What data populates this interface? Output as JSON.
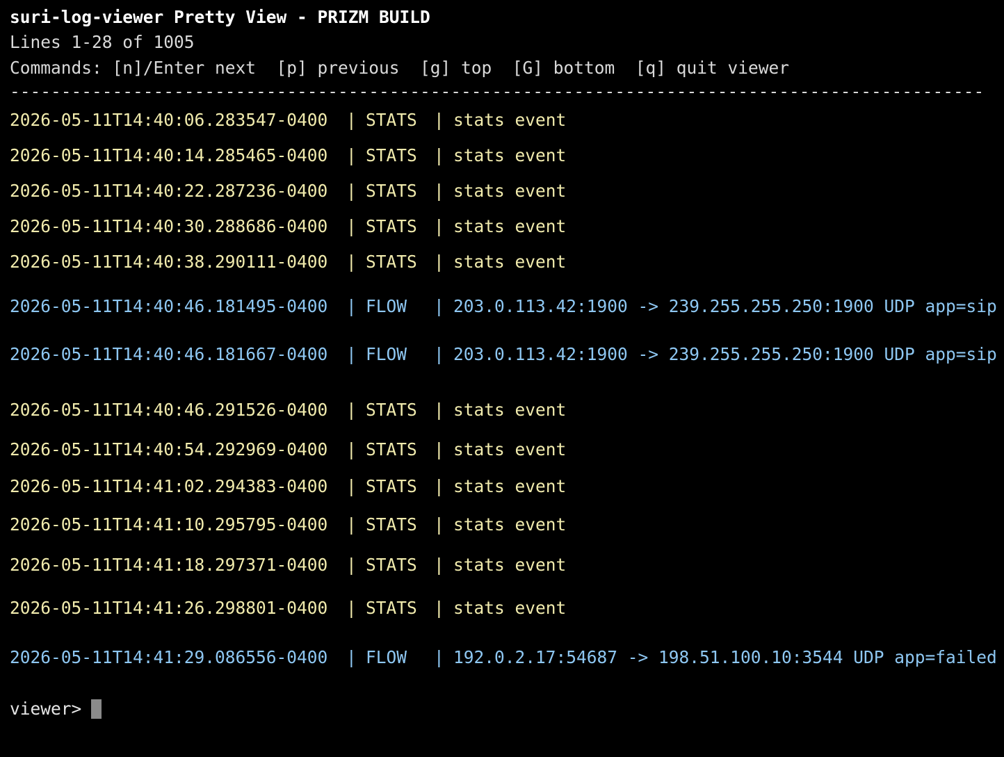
{
  "header": {
    "title": "suri-log-viewer Pretty View - PRIZM BUILD",
    "lines_info": "Lines 1-28 of 1005",
    "commands": "Commands: [n]/Enter next  [p] previous  [g] top  [G] bottom  [q] quit viewer",
    "divider": "-----------------------------------------------------------------------------------------------"
  },
  "colors": {
    "stats": "#f1ebad",
    "flow": "#8ec7f2",
    "background": "#000000"
  },
  "rows": [
    {
      "ts": "2026-05-11T14:40:06.283547-0400",
      "type": "STATS",
      "msg": "stats event",
      "kind": "stats"
    },
    {
      "ts": "2026-05-11T14:40:14.285465-0400",
      "type": "STATS",
      "msg": "stats event",
      "kind": "stats"
    },
    {
      "ts": "2026-05-11T14:40:22.287236-0400",
      "type": "STATS",
      "msg": "stats event",
      "kind": "stats"
    },
    {
      "ts": "2026-05-11T14:40:30.288686-0400",
      "type": "STATS",
      "msg": "stats event",
      "kind": "stats"
    },
    {
      "ts": "2026-05-11T14:40:38.290111-0400",
      "type": "STATS",
      "msg": "stats event",
      "kind": "stats"
    },
    {
      "ts": "2026-05-11T14:40:46.181495-0400",
      "type": "FLOW",
      "msg": "203.0.113.42:1900 -> 239.255.255.250:1900 UDP app=sip",
      "kind": "flow"
    },
    {
      "ts": "2026-05-11T14:40:46.181667-0400",
      "type": "FLOW",
      "msg": "203.0.113.42:1900 -> 239.255.255.250:1900 UDP app=sip",
      "kind": "flow"
    },
    {
      "ts": "2026-05-11T14:40:46.291526-0400",
      "type": "STATS",
      "msg": "stats event",
      "kind": "stats"
    },
    {
      "ts": "2026-05-11T14:40:54.292969-0400",
      "type": "STATS",
      "msg": "stats event",
      "kind": "stats"
    },
    {
      "ts": "2026-05-11T14:41:02.294383-0400",
      "type": "STATS",
      "msg": "stats event",
      "kind": "stats"
    },
    {
      "ts": "2026-05-11T14:41:10.295795-0400",
      "type": "STATS",
      "msg": "stats event",
      "kind": "stats"
    },
    {
      "ts": "2026-05-11T14:41:18.297371-0400",
      "type": "STATS",
      "msg": "stats event",
      "kind": "stats"
    },
    {
      "ts": "2026-05-11T14:41:26.298801-0400",
      "type": "STATS",
      "msg": "stats event",
      "kind": "stats"
    },
    {
      "ts": "2026-05-11T14:41:29.086556-0400",
      "type": "FLOW",
      "msg": "192.0.2.17:54687 -> 198.51.100.10:3544 UDP app=failed",
      "kind": "flow"
    }
  ],
  "prompt": {
    "label": "viewer>",
    "value": ""
  }
}
